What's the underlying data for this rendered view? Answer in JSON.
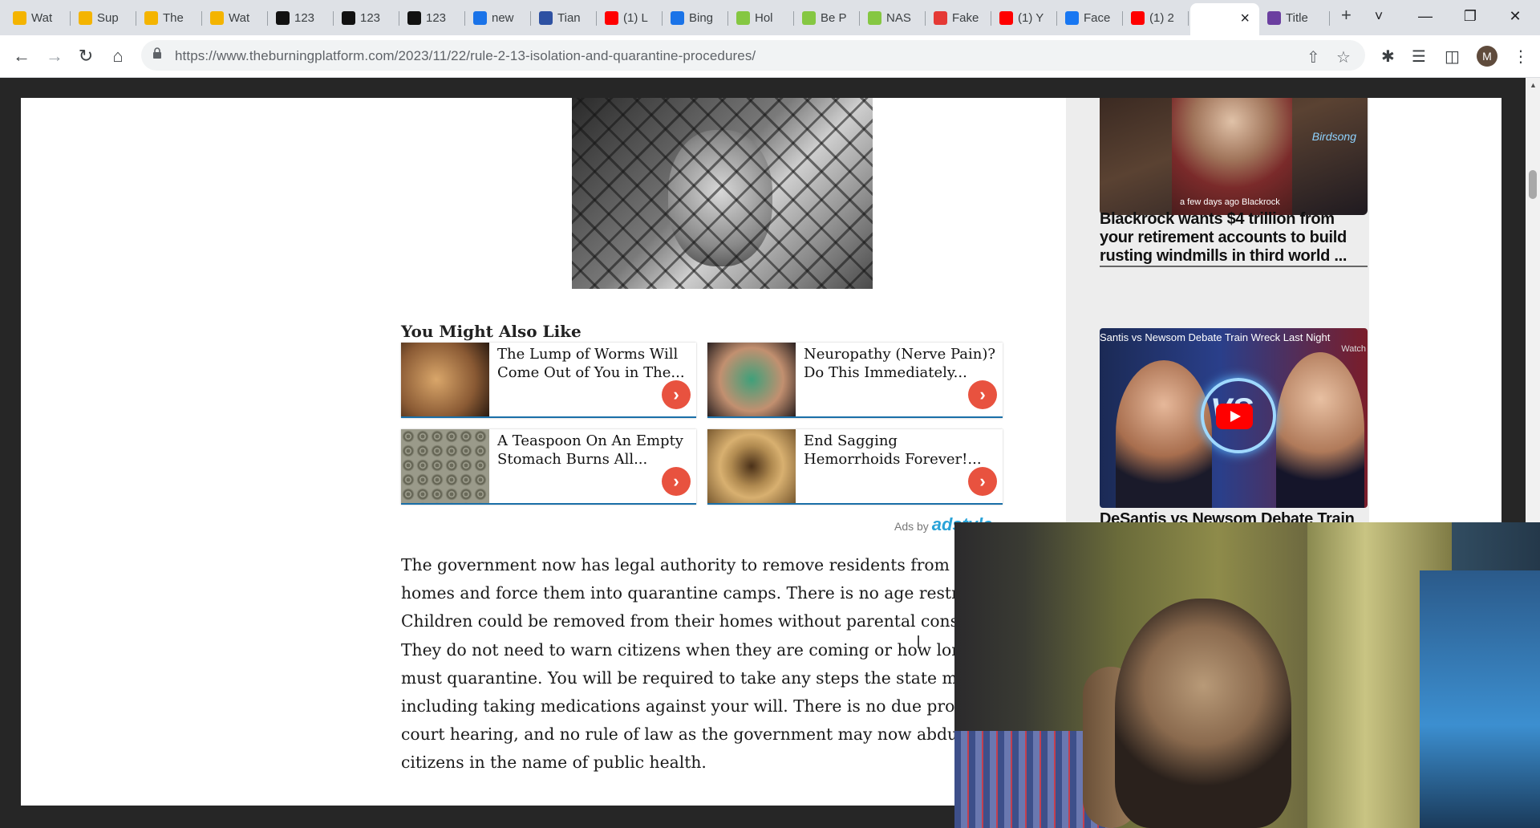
{
  "browser": {
    "tabs": [
      {
        "label": "Wat",
        "icon": "folder-icon",
        "color": "#f4b400"
      },
      {
        "label": "Sup",
        "icon": "folder-icon",
        "color": "#f4b400"
      },
      {
        "label": "The",
        "icon": "folder-icon",
        "color": "#f4b400"
      },
      {
        "label": "Wat",
        "icon": "folder-icon",
        "color": "#f4b400"
      },
      {
        "label": "123",
        "icon": "123-icon",
        "color": "#111111"
      },
      {
        "label": "123",
        "icon": "123-icon",
        "color": "#111111"
      },
      {
        "label": "123",
        "icon": "123-icon",
        "color": "#111111"
      },
      {
        "label": "new",
        "icon": "search-icon",
        "color": "#1a73e8"
      },
      {
        "label": "Tian",
        "icon": "mal-icon",
        "color": "#2e51a2"
      },
      {
        "label": "(1) L",
        "icon": "youtube-icon",
        "color": "#ff0000"
      },
      {
        "label": "Bing",
        "icon": "search-icon",
        "color": "#1a73e8"
      },
      {
        "label": "Hol",
        "icon": "rumble-icon",
        "color": "#85c742"
      },
      {
        "label": "Be P",
        "icon": "rumble-icon",
        "color": "#85c742"
      },
      {
        "label": "NAS",
        "icon": "rumble-icon",
        "color": "#85c742"
      },
      {
        "label": "Fake",
        "icon": "refresh-logo-icon",
        "color": "#e53935"
      },
      {
        "label": "(1) Y",
        "icon": "youtube-icon",
        "color": "#ff0000"
      },
      {
        "label": "Face",
        "icon": "facebook-icon",
        "color": "#1877f2"
      },
      {
        "label": "(1) 2",
        "icon": "youtube-icon",
        "color": "#ff0000"
      },
      {
        "label": "",
        "icon": "",
        "color": "#ffffff",
        "active": true
      },
      {
        "label": "Title",
        "icon": "site-icon",
        "color": "#6b3fa0"
      }
    ],
    "new_tab": "+",
    "url_host": "https://www.theburningplatform.com",
    "url_path": "/2023/11/22/rule-2-13-isolation-and-quarantine-procedures/",
    "profile_initial": "M"
  },
  "page": {
    "section_title": "You Might Also Like",
    "ads": [
      {
        "title": "The Lump of Worms Will Come Out of You in The..."
      },
      {
        "title": "Neuropathy (Nerve Pain)? Do This Immediately..."
      },
      {
        "title": "A Teaspoon On An Empty Stomach Burns All..."
      },
      {
        "title": "End Sagging Hemorrhoids Forever!..."
      }
    ],
    "ads_by": "Ads by",
    "ads_brand": "adstyle",
    "article_lines": [
      "The government now has legal authority to remove residents from the",
      "homes and force them into quarantine camps. There is no age restricti",
      "Children could be removed from their homes without parental consent",
      "They do not need to warn citizens when they are coming or how long t",
      "must quarantine. You will be required to take any steps the state mand",
      "including taking medications against your will. There is no due proces",
      "court hearing, and no rule of law as the government may now abduct",
      "citizens in the name of public health."
    ]
  },
  "sidebar": {
    "video1_caption": "a few days ago Blackrock",
    "video1_logo": "Birdsong",
    "story1_title": "Blackrock wants $4 trillion from your retirement accounts to build rusting windmills in third world ...",
    "video2_caption": "Santis vs Newsom Debate Train Wreck Last Night",
    "video2_watch": "Watch",
    "video2_badge": "VS",
    "story2_title": "DeSantis vs Newsom Debate Train"
  }
}
